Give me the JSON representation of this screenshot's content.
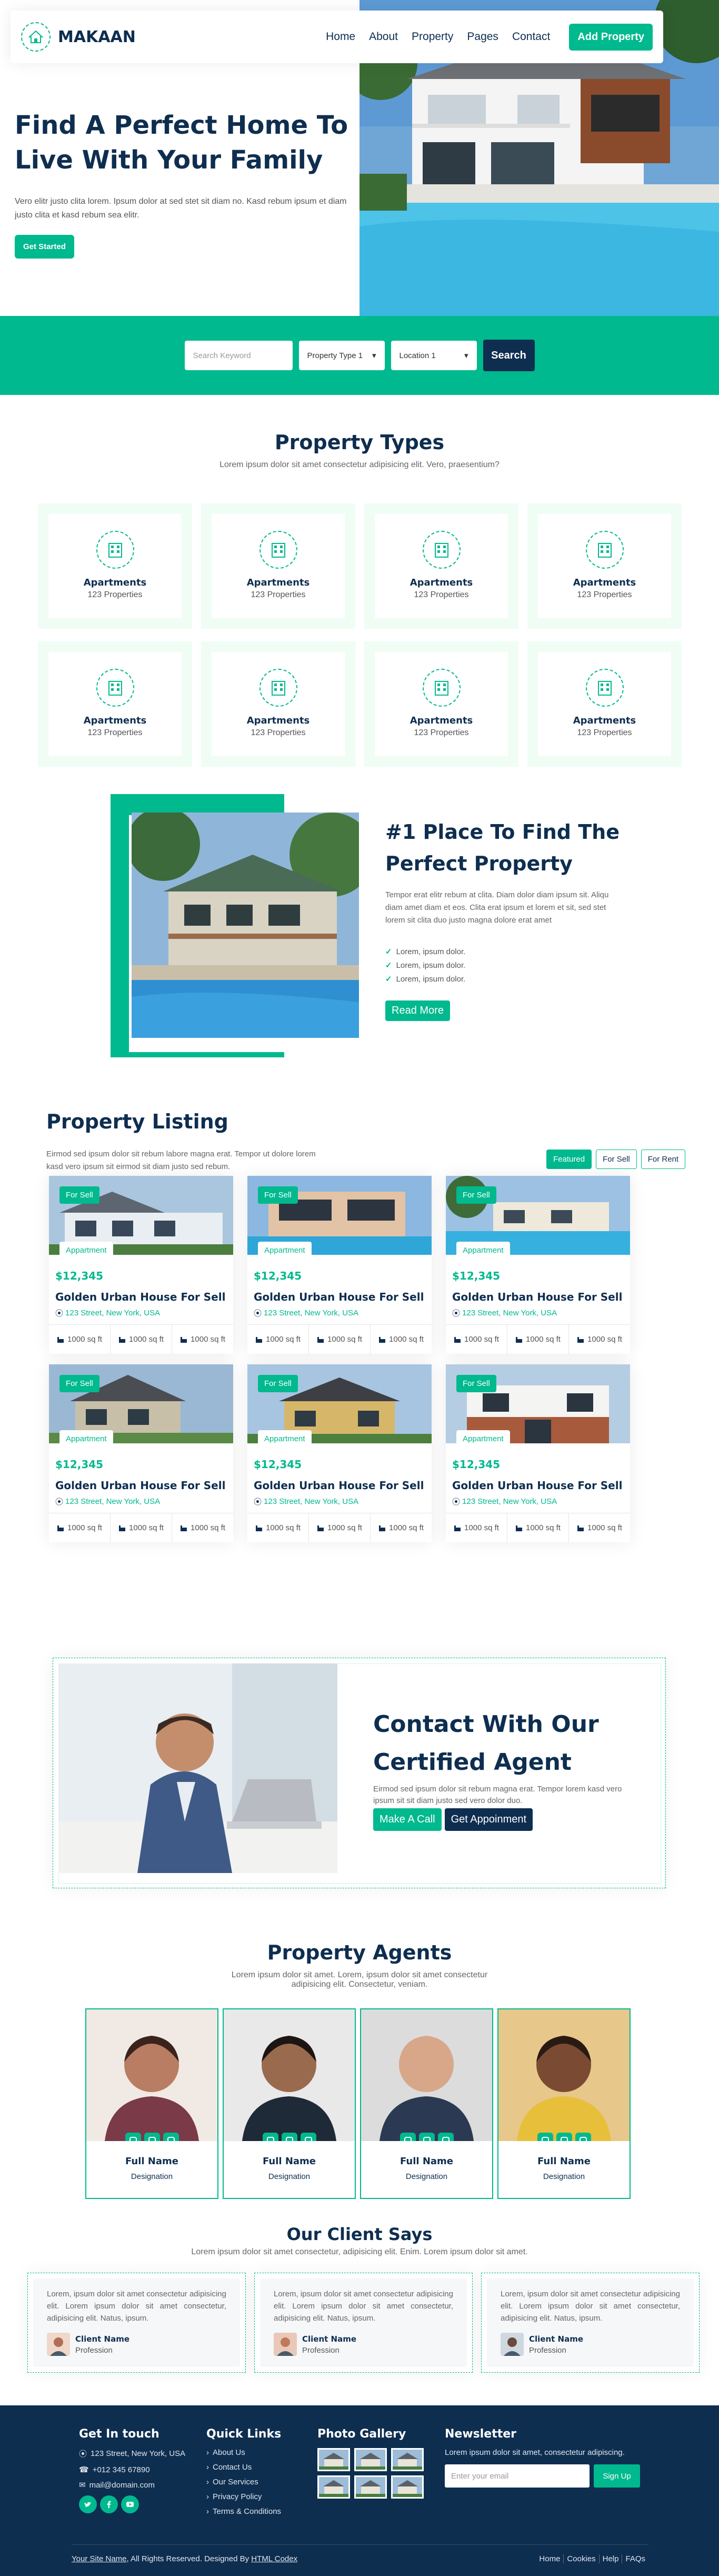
{
  "brand": {
    "name": "MAKAAN",
    "color_primary": "#00B98E",
    "color_dark": "#0E2E50"
  },
  "nav": {
    "links": [
      "Home",
      "About",
      "Property",
      "Pages",
      "Contact"
    ],
    "cta": "Add Property"
  },
  "hero": {
    "title": "Find A Perfect Home To Live With Your Family",
    "text": "Vero elitr justo clita lorem. Ipsum dolor at sed stet sit diam no. Kasd rebum ipsum et diam justo clita et kasd rebum sea elitr.",
    "button": "Get Started"
  },
  "search": {
    "placeholder": "Search Keyword",
    "type_select": "Property Type 1",
    "location_select": "Location 1",
    "button": "Search"
  },
  "types": {
    "title": "Property Types",
    "subtitle": "Lorem ipsum dolor sit amet consectetur adipisicing elit. Vero, praesentium?",
    "items": [
      {
        "name": "Apartments",
        "count": "123 Properties"
      },
      {
        "name": "Apartments",
        "count": "123 Properties"
      },
      {
        "name": "Apartments",
        "count": "123 Properties"
      },
      {
        "name": "Apartments",
        "count": "123 Properties"
      },
      {
        "name": "Apartments",
        "count": "123 Properties"
      },
      {
        "name": "Apartments",
        "count": "123 Properties"
      },
      {
        "name": "Apartments",
        "count": "123 Properties"
      },
      {
        "name": "Apartments",
        "count": "123 Properties"
      }
    ]
  },
  "about": {
    "title": "#1 Place To Find The Perfect Property",
    "text": "Tempor erat elitr rebum at clita. Diam dolor diam ipsum sit. Aliqu diam amet diam et eos. Clita erat ipsum et lorem et sit, sed stet lorem sit clita duo justo magna dolore erat amet",
    "list": [
      "Lorem, ipsum dolor.",
      "Lorem, ipsum dolor.",
      "Lorem, ipsum dolor."
    ],
    "button": "Read More"
  },
  "listing": {
    "title": "Property Listing",
    "text": "Eirmod sed ipsum dolor sit rebum labore magna erat. Tempor ut dolore lorem kasd vero ipsum sit eirmod sit diam justo sed rebum.",
    "tabs": [
      "Featured",
      "For Sell",
      "For Rent"
    ],
    "properties": [
      {
        "status": "For Sell",
        "type": "Appartment",
        "price": "$12,345",
        "name": "Golden Urban House For Sell",
        "address": "123 Street, New York, USA",
        "f1": "1000 sq ft",
        "f2": "1000 sq ft",
        "f3": "1000 sq ft"
      },
      {
        "status": "For Sell",
        "type": "Appartment",
        "price": "$12,345",
        "name": "Golden Urban House For Sell",
        "address": "123 Street, New York, USA",
        "f1": "1000 sq ft",
        "f2": "1000 sq ft",
        "f3": "1000 sq ft"
      },
      {
        "status": "For Sell",
        "type": "Appartment",
        "price": "$12,345",
        "name": "Golden Urban House For Sell",
        "address": "123 Street, New York, USA",
        "f1": "1000 sq ft",
        "f2": "1000 sq ft",
        "f3": "1000 sq ft"
      },
      {
        "status": "For Sell",
        "type": "Appartment",
        "price": "$12,345",
        "name": "Golden Urban House For Sell",
        "address": "123 Street, New York, USA",
        "f1": "1000 sq ft",
        "f2": "1000 sq ft",
        "f3": "1000 sq ft"
      },
      {
        "status": "For Sell",
        "type": "Appartment",
        "price": "$12,345",
        "name": "Golden Urban House For Sell",
        "address": "123 Street, New York, USA",
        "f1": "1000 sq ft",
        "f2": "1000 sq ft",
        "f3": "1000 sq ft"
      },
      {
        "status": "For Sell",
        "type": "Appartment",
        "price": "$12,345",
        "name": "Golden Urban House For Sell",
        "address": "123 Street, New York, USA",
        "f1": "1000 sq ft",
        "f2": "1000 sq ft",
        "f3": "1000 sq ft"
      }
    ]
  },
  "contact": {
    "title": "Contact With Our Certified Agent",
    "text": "Eirmod sed ipsum dolor sit rebum magna erat. Tempor lorem kasd vero ipsum sit sit diam justo sed vero dolor duo.",
    "call": "Make A Call",
    "appointment": "Get Appoinment"
  },
  "agents": {
    "title": "Property Agents",
    "subtitle": "Lorem ipsum dolor sit amet. Lorem, ipsum dolor sit amet consectetur adipisicing elit. Consectetur, veniam.",
    "items": [
      {
        "name": "Full Name",
        "designation": "Designation"
      },
      {
        "name": "Full Name",
        "designation": "Designation"
      },
      {
        "name": "Full Name",
        "designation": "Designation"
      },
      {
        "name": "Full Name",
        "designation": "Designation"
      }
    ]
  },
  "testimonials": {
    "title": "Our Client Says",
    "subtitle": "Lorem ipsum dolor sit amet consectetur, adipisicing elit. Enim. Lorem ipsum dolor sit amet.",
    "items": [
      {
        "quote": "Lorem, ipsum dolor sit amet consectetur adipisicing elit. Lorem ipsum dolor sit amet consectetur, adipisicing elit. Natus, ipsum.",
        "name": "Client Name",
        "profession": "Profession"
      },
      {
        "quote": "Lorem, ipsum dolor sit amet consectetur adipisicing elit. Lorem ipsum dolor sit amet consectetur, adipisicing elit. Natus, ipsum.",
        "name": "Client Name",
        "profession": "Profession"
      },
      {
        "quote": "Lorem, ipsum dolor sit amet consectetur adipisicing elit. Lorem ipsum dolor sit amet consectetur, adipisicing elit. Natus, ipsum.",
        "name": "Client Name",
        "profession": "Profession"
      }
    ]
  },
  "footer": {
    "touch_title": "Get In touch",
    "address": "123 Street, New York, USA",
    "phone": "+012 345 67890",
    "email": "mail@domain.com",
    "links_title": "Quick Links",
    "links": [
      "About Us",
      "Contact Us",
      "Our Services",
      "Privacy Policy",
      "Terms & Conditions"
    ],
    "gallery_title": "Photo Gallery",
    "newsletter_title": "Newsletter",
    "newsletter_text": "Lorem ipsum dolor sit amet, consectetur adipiscing.",
    "newsletter_placeholder": "Enter your email",
    "newsletter_button": "Sign Up",
    "site_name": "Your Site Name",
    "rights": ", All Rights Reserved. Designed By ",
    "designer": "HTML Codex",
    "bottom_links": [
      "Home",
      "Cookies",
      "Help",
      "FAQs"
    ]
  }
}
